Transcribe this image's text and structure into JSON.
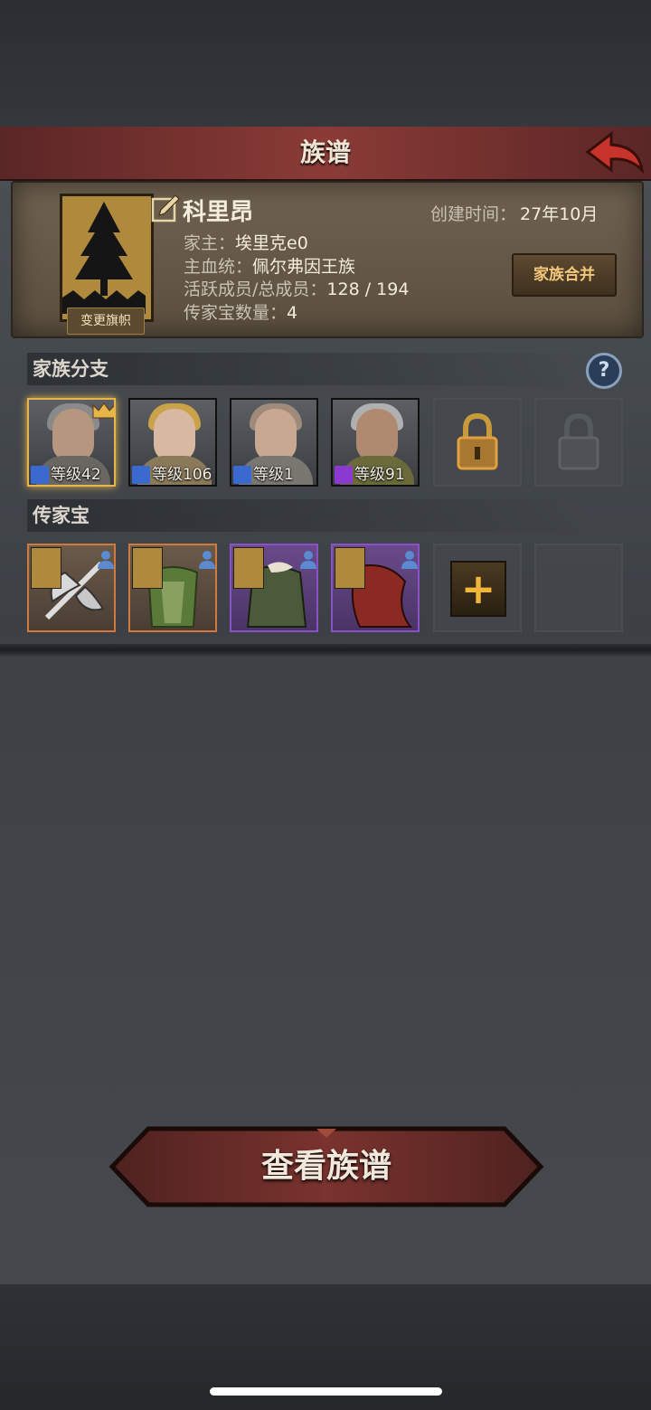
{
  "header": {
    "title": "族谱",
    "back_icon": "back-arrow-icon"
  },
  "family": {
    "change_flag_label": "变更旗帜",
    "name": "科里昂",
    "created_label": "创建时间：",
    "created_value": "27年10月",
    "head_label": "家主：",
    "head_value": "埃里克e0",
    "bloodline_label": "主血统：",
    "bloodline_value": "佩尔弗因王族",
    "members_label": "活跃成员/总成员：",
    "members_value": "128 / 194",
    "heirloom_count_label": "传家宝数量：",
    "heirloom_count_value": "4",
    "merge_label": "家族合并"
  },
  "branches": {
    "title": "家族分支",
    "help_label": "?",
    "members": [
      {
        "level": "等级42",
        "class_icon": "sword-icon",
        "leader": true
      },
      {
        "level": "等级106",
        "class_icon": "sword-star-icon",
        "leader": false
      },
      {
        "level": "等级1",
        "class_icon": "sword-icon",
        "leader": false
      },
      {
        "level": "等级91",
        "class_icon": "staff-icon",
        "leader": false
      }
    ],
    "locked_slots": [
      "lock-icon",
      "lock-icon"
    ]
  },
  "heirlooms": {
    "title": "传家宝",
    "add_label": "+",
    "items": [
      {
        "name": "axe-item-icon",
        "rarity": "orange"
      },
      {
        "name": "armor-item-icon",
        "rarity": "orange"
      },
      {
        "name": "cloak-item-icon",
        "rarity": "purple"
      },
      {
        "name": "cape-item-icon",
        "rarity": "purple"
      }
    ]
  },
  "footer": {
    "view_button_label": "查看族谱"
  },
  "colors": {
    "title_bar": "#8b3b36",
    "gold": "#e7b54a",
    "orange_rarity": "#d07a3e",
    "purple_rarity": "#8a52c8"
  }
}
